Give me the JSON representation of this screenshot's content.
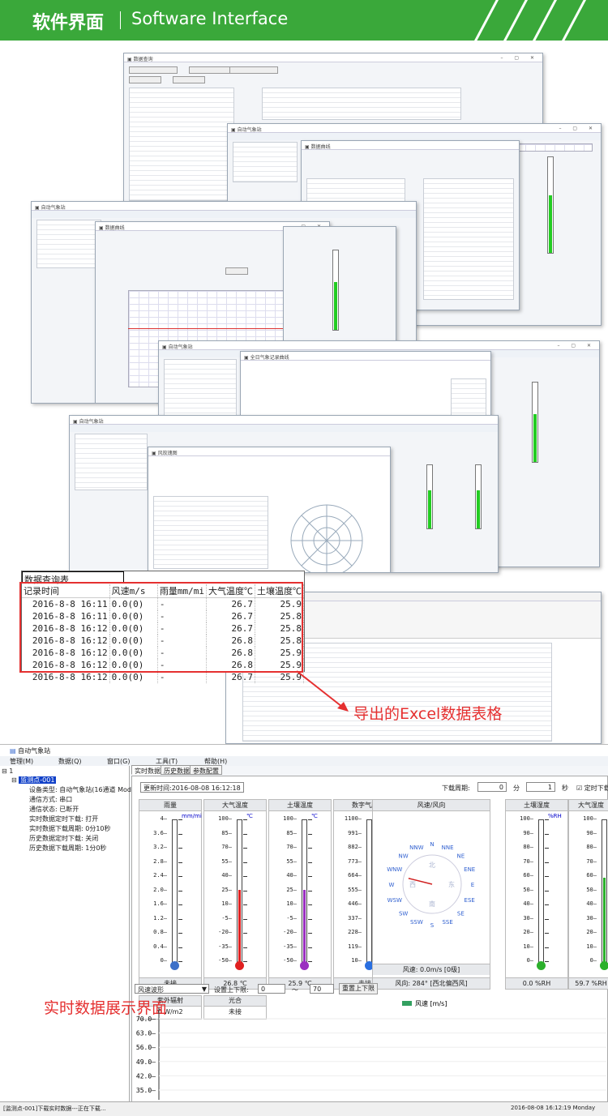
{
  "header": {
    "title_cn": "软件界面",
    "title_en": "Software Interface"
  },
  "annotations": {
    "excel_caption": "导出的Excel数据表格",
    "realtime_caption": "实时数据展示界面"
  },
  "excel": {
    "title": "数据查询表",
    "headers": [
      "记录时间",
      "风速m/s",
      "雨量mm/mi",
      "大气温度℃",
      "土壤温度℃"
    ],
    "rows": [
      [
        "2016-8-8 16:11",
        "0.0(0)",
        "-",
        "26.7",
        "25.9"
      ],
      [
        "2016-8-8 16:11",
        "0.0(0)",
        "-",
        "26.7",
        "25.8"
      ],
      [
        "2016-8-8 16:12",
        "0.0(0)",
        "-",
        "26.7",
        "25.8"
      ],
      [
        "2016-8-8 16:12",
        "0.0(0)",
        "-",
        "26.8",
        "25.8"
      ],
      [
        "2016-8-8 16:12",
        "0.0(0)",
        "-",
        "26.8",
        "25.9"
      ],
      [
        "2016-8-8 16:12",
        "0.0(0)",
        "-",
        "26.8",
        "25.9"
      ],
      [
        "2016-8-8 16:12",
        "0.0(0)",
        "-",
        "26.7",
        "25.9"
      ]
    ]
  },
  "app": {
    "window_title": "自动气象站",
    "menu": [
      "管理(M)",
      "数据(Q)",
      "窗口(G)",
      "工具(T)",
      "帮助(H)"
    ],
    "tree": {
      "root": "1",
      "node": "监测点-001",
      "items": [
        "设备类型: 自动气象站(16通道 Modl",
        "通信方式: 串口",
        "通信状态: 已断开",
        "实时数据定时下载: 打开",
        "实时数据下载周期: 0分10秒",
        "历史数据定时下载: 关闭",
        "历史数据下载周期: 1分0秒"
      ]
    },
    "tabs": [
      "实时数据",
      "历史数据",
      "参数配置"
    ],
    "update_time": "更新时间:2016-08-08 16:12:18",
    "download_period_label": "下载周期:",
    "min_value": "0",
    "min_label": "分",
    "sec_value": "1",
    "sec_label": "秒",
    "timed_download": "定时下载",
    "gauges": [
      {
        "name": "雨量",
        "unit": "mm/mi",
        "ticks": [
          "4",
          "3.6",
          "3.2",
          "2.8",
          "2.4",
          "2.0",
          "1.6",
          "1.2",
          "0.8",
          "0.4",
          "0"
        ],
        "fill": 0.0,
        "color": "#3c70c8",
        "value": "未接"
      },
      {
        "name": "大气温度",
        "unit": "℃",
        "ticks": [
          "100",
          "85",
          "70",
          "55",
          "40",
          "25",
          "10",
          "-5",
          "-20",
          "-35",
          "-50"
        ],
        "fill": 0.51,
        "color": "#e02020",
        "value": "26.8 ℃"
      },
      {
        "name": "土壤温度",
        "unit": "℃",
        "ticks": [
          "100",
          "85",
          "70",
          "55",
          "40",
          "25",
          "10",
          "-5",
          "-20",
          "-35",
          "-50"
        ],
        "fill": 0.51,
        "color": "#9a30c0",
        "value": "25.9 ℃"
      },
      {
        "name": "数字气压",
        "unit": "hpa",
        "ticks": [
          "1100",
          "991",
          "882",
          "773",
          "664",
          "555",
          "446",
          "337",
          "228",
          "119",
          "10"
        ],
        "fill": 0.0,
        "color": "#2a6fe0",
        "value": "未接"
      },
      {
        "name": "土壤湿度",
        "unit": "%RH",
        "ticks": [
          "100",
          "90",
          "80",
          "70",
          "60",
          "50",
          "40",
          "30",
          "20",
          "10",
          "0"
        ],
        "fill": 0.0,
        "color": "#2cb02c",
        "value": "0.0 %RH"
      },
      {
        "name": "大气湿度",
        "unit": "%RH",
        "ticks": [
          "100",
          "90",
          "80",
          "70",
          "60",
          "50",
          "40",
          "30",
          "20",
          "10",
          "0"
        ],
        "fill": 0.597,
        "color": "#2cb02c",
        "value": "59.7 %RH"
      }
    ],
    "wind": {
      "title": "风速/风向",
      "directions": [
        "N",
        "NNE",
        "NE",
        "ENE",
        "E",
        "ESE",
        "SE",
        "SSE",
        "S",
        "SSW",
        "SW",
        "WSW",
        "W",
        "WNW",
        "NW",
        "NNW"
      ],
      "cn_dirs": [
        "北",
        "东",
        "南",
        "西"
      ],
      "speed": "风速: 0.0m/s [0级]",
      "direction": "风向: 284° [西北偏西风]",
      "angle": 284
    },
    "uv": {
      "name": "紫外辐射",
      "value": "0 W/m2"
    },
    "light": {
      "name": "光合",
      "value": "未接"
    },
    "chart_select": "风速波形",
    "limit_label": "设置上下限:",
    "limit_low": "0",
    "limit_sep": "～",
    "limit_high": "70",
    "reset_button": "重置上下限",
    "status_left": "[监测点-001]下载实时数据---正在下载...",
    "status_right": "2016-08-08 16:12:19 Monday"
  },
  "chart_data": {
    "type": "line",
    "series": [
      {
        "name": "风速 [m/s]",
        "values": []
      }
    ],
    "y_ticks": [
      "70.0",
      "63.0",
      "56.0",
      "49.0",
      "42.0",
      "35.0"
    ],
    "ylim": [
      35,
      70
    ]
  }
}
